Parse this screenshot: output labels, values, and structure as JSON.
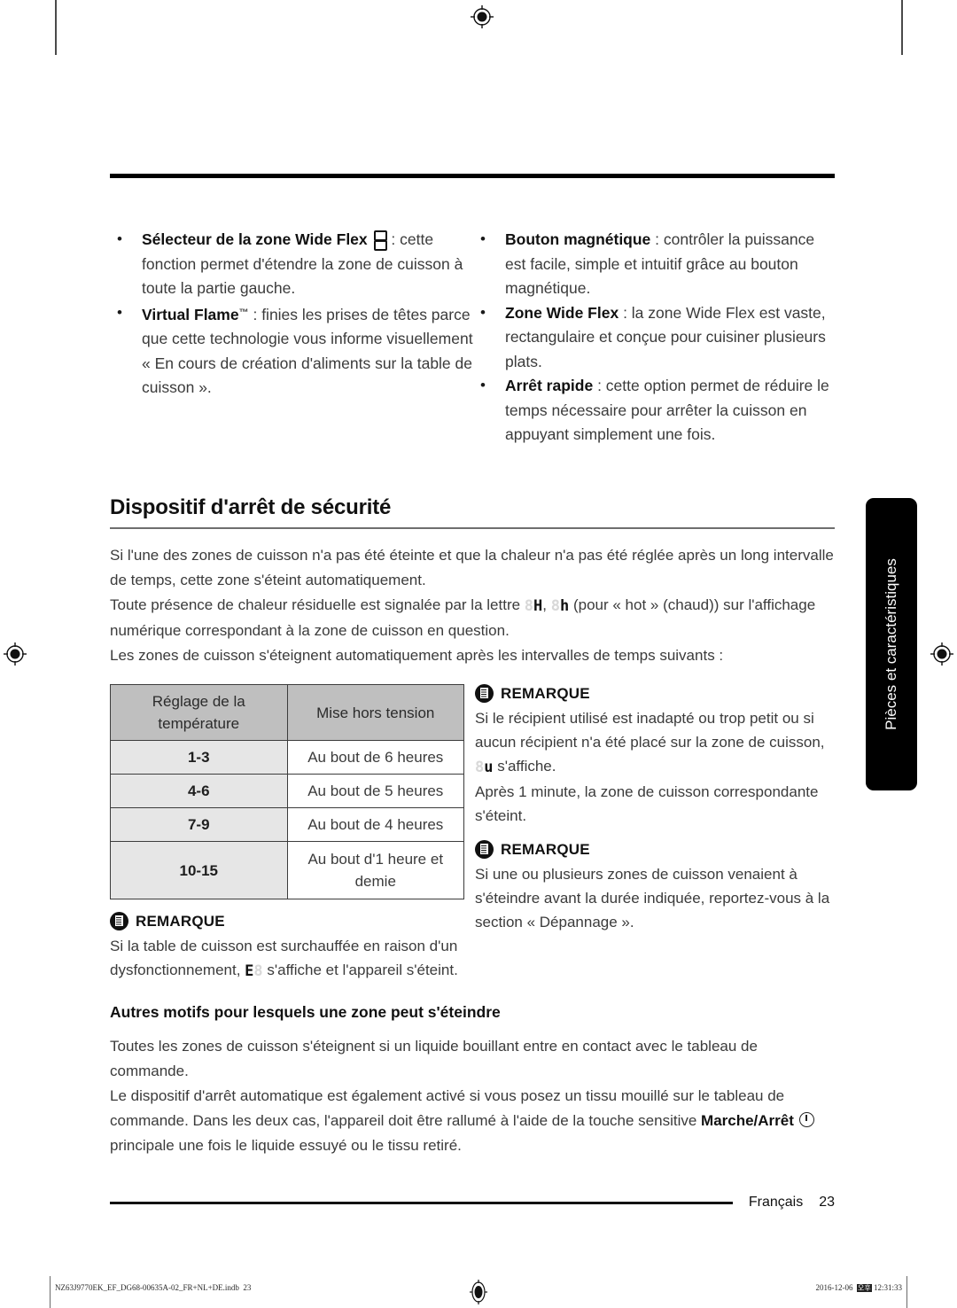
{
  "document": {
    "language_footer": "Français",
    "page_number": "23",
    "side_tab": "Pièces et caractéristiques"
  },
  "features": {
    "left_column": [
      {
        "term": "Sélecteur de la zone Wide Flex",
        "icon": "wide-flex-zone-icon",
        "separator": " :",
        "description": "cette fonction permet d'étendre la zone de cuisson à toute la partie gauche."
      },
      {
        "term": "Virtual Flame",
        "trademark": "™",
        "separator": " : ",
        "description": "finies les prises de têtes parce que cette technologie vous informe visuellement « En cours de création d'aliments sur la table de cuisson »."
      }
    ],
    "right_column": [
      {
        "term": "Bouton magnétique",
        "separator": " : ",
        "description": "contrôler la puissance est facile, simple et intuitif grâce au bouton magnétique."
      },
      {
        "term": "Zone Wide Flex",
        "separator": "  : ",
        "description": "la zone Wide Flex est vaste, rectangulaire et conçue pour cuisiner plusieurs plats."
      },
      {
        "term": "Arrêt rapide",
        "separator": " : ",
        "description": "cette option permet de réduire le temps nécessaire pour arrêter la cuisson en appuyant simplement une fois."
      }
    ]
  },
  "safety_section": {
    "title": "Dispositif d'arrêt de sécurité",
    "paragraph_1": "Si l'une des zones de cuisson n'a pas été éteinte et que la chaleur n'a pas été réglée après un long intervalle de temps, cette zone s'éteint automatiquement.",
    "paragraph_2_prefix": "Toute présence de chaleur résiduelle est signalée par la lettre ",
    "residual_glyph_1": "H",
    "residual_glyph_sep": ", ",
    "residual_glyph_2": "h",
    "paragraph_2_suffix": " (pour « hot » (chaud)) sur l'affichage numérique correspondant à la zone de cuisson en question.",
    "paragraph_3": "Les zones de cuisson s'éteignent automatiquement après les intervalles de temps suivants :"
  },
  "shutdown_table": {
    "headers": [
      "Réglage de la température",
      "Mise hors tension"
    ],
    "rows": [
      {
        "setting": "1-3",
        "result": "Au bout de 6 heures"
      },
      {
        "setting": "4-6",
        "result": "Au bout de 5 heures"
      },
      {
        "setting": "7-9",
        "result": "Au bout de 4 heures"
      },
      {
        "setting": "10-15",
        "result": "Au bout d'1 heure et demie"
      }
    ]
  },
  "notes": {
    "label": "REMARQUE",
    "left_note": {
      "text_before_glyph": "Si la table de cuisson est surchauffée en raison d'un dysfonctionnement, ",
      "glyph": "E",
      "text_after_glyph": " s'affiche et l'appareil s'éteint."
    },
    "right_note_1": {
      "text_before_glyph": "Si le récipient utilisé est inadapté ou trop petit ou si aucun récipient n'a été placé sur la zone de cuisson, ",
      "glyph": "u",
      "text_after_glyph": " s'affiche.",
      "second_paragraph": "Après 1 minute, la zone de cuisson correspondante s'éteint."
    },
    "right_note_2": {
      "text": "Si une ou plusieurs zones de cuisson venaient à s'éteindre avant la durée indiquée, reportez-vous à la section « Dépannage »."
    }
  },
  "other_reasons": {
    "title": "Autres motifs pour lesquels une zone peut s'éteindre",
    "paragraph_1": "Toutes les zones de cuisson s'éteignent si un liquide bouillant entre en contact avec le tableau de commande.",
    "paragraph_2_part1": "Le dispositif d'arrêt automatique est également activé si vous posez un tissu mouillé sur le tableau de commande. Dans les deux cas, l'appareil doit être rallumé à l'aide de la touche sensitive ",
    "paragraph_2_bold": "Marche/Arrêt",
    "paragraph_2_part2": " principale une fois le liquide essuyé ou le tissu retiré."
  },
  "production_footer": {
    "file_name": "NZ63J9770EK_EF_DG68-00635A-02_FR+NL+DE.indb",
    "file_page": "23",
    "date": "2016-12-06",
    "locale_marker": "오후",
    "time": "12:31:33"
  }
}
